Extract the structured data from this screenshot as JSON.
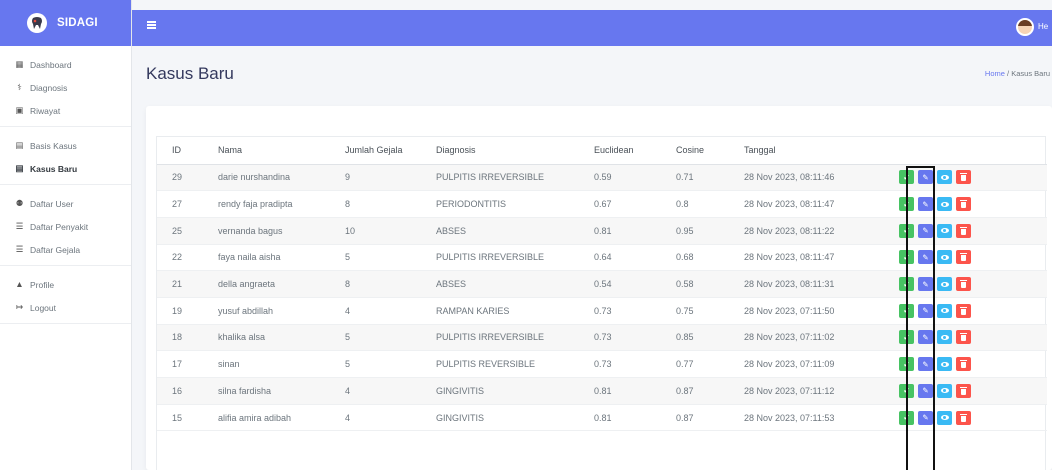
{
  "app": {
    "brand": "SIDAGI",
    "brand_color": "#6777ef",
    "user_name": "He"
  },
  "sidebar": {
    "groups": [
      [
        {
          "label": "Dashboard",
          "icon": "table-icon"
        },
        {
          "label": "Diagnosis",
          "icon": "stethoscope-icon"
        },
        {
          "label": "Riwayat",
          "icon": "history-icon"
        }
      ],
      [
        {
          "label": "Basis Kasus",
          "icon": "briefcase-icon"
        },
        {
          "label": "Kasus Baru",
          "icon": "briefcase-icon",
          "active": true
        }
      ],
      [
        {
          "label": "Daftar User",
          "icon": "users-icon"
        },
        {
          "label": "Daftar Penyakit",
          "icon": "list-icon"
        },
        {
          "label": "Daftar Gejala",
          "icon": "list-icon"
        }
      ],
      [
        {
          "label": "Profile",
          "icon": "user-icon"
        },
        {
          "label": "Logout",
          "icon": "logout-icon"
        }
      ]
    ]
  },
  "page": {
    "title": "Kasus Baru",
    "breadcrumb": {
      "home": "Home",
      "separator": "/",
      "current": "Kasus Baru"
    }
  },
  "table": {
    "columns": [
      "ID",
      "Nama",
      "Jumlah Gejala",
      "Diagnosis",
      "Euclidean",
      "Cosine",
      "Tanggal"
    ],
    "rows": [
      {
        "id": "29",
        "nama": "darie nurshandina",
        "jumlah_gejala": "9",
        "diagnosis": "PULPITIS IRREVERSIBLE",
        "euclidean": "0.59",
        "cosine": "0.71",
        "tanggal": "28 Nov 2023, 08:11:46"
      },
      {
        "id": "27",
        "nama": "rendy faja pradipta",
        "jumlah_gejala": "8",
        "diagnosis": "PERIODONTITIS",
        "euclidean": "0.67",
        "cosine": "0.8",
        "tanggal": "28 Nov 2023, 08:11:47"
      },
      {
        "id": "25",
        "nama": "vernanda bagus",
        "jumlah_gejala": "10",
        "diagnosis": "ABSES",
        "euclidean": "0.81",
        "cosine": "0.95",
        "tanggal": "28 Nov 2023, 08:11:22"
      },
      {
        "id": "22",
        "nama": "faya naila aisha",
        "jumlah_gejala": "5",
        "diagnosis": "PULPITIS IRREVERSIBLE",
        "euclidean": "0.64",
        "cosine": "0.68",
        "tanggal": "28 Nov 2023, 08:11:47"
      },
      {
        "id": "21",
        "nama": "della angraeta",
        "jumlah_gejala": "8",
        "diagnosis": "ABSES",
        "euclidean": "0.54",
        "cosine": "0.58",
        "tanggal": "28 Nov 2023, 08:11:31"
      },
      {
        "id": "19",
        "nama": "yusuf abdillah",
        "jumlah_gejala": "4",
        "diagnosis": "RAMPAN KARIES",
        "euclidean": "0.73",
        "cosine": "0.75",
        "tanggal": "28 Nov 2023, 07:11:50"
      },
      {
        "id": "18",
        "nama": "khalika alsa",
        "jumlah_gejala": "5",
        "diagnosis": "PULPITIS IRREVERSIBLE",
        "euclidean": "0.73",
        "cosine": "0.85",
        "tanggal": "28 Nov 2023, 07:11:02"
      },
      {
        "id": "17",
        "nama": "sinan",
        "jumlah_gejala": "5",
        "diagnosis": "PULPITIS REVERSIBLE",
        "euclidean": "0.73",
        "cosine": "0.77",
        "tanggal": "28 Nov 2023, 07:11:09"
      },
      {
        "id": "16",
        "nama": "silna fardisha",
        "jumlah_gejala": "4",
        "diagnosis": "GINGIVITIS",
        "euclidean": "0.81",
        "cosine": "0.87",
        "tanggal": "28 Nov 2023, 07:11:12"
      },
      {
        "id": "15",
        "nama": "alifia amira adibah",
        "jumlah_gejala": "4",
        "diagnosis": "GINGIVITIS",
        "euclidean": "0.81",
        "cosine": "0.87",
        "tanggal": "28 Nov 2023, 07:11:53"
      }
    ],
    "action_colors": {
      "approve": "#47c363",
      "edit": "#6777ef",
      "view": "#3abaf4",
      "delete": "#fc544b"
    }
  }
}
